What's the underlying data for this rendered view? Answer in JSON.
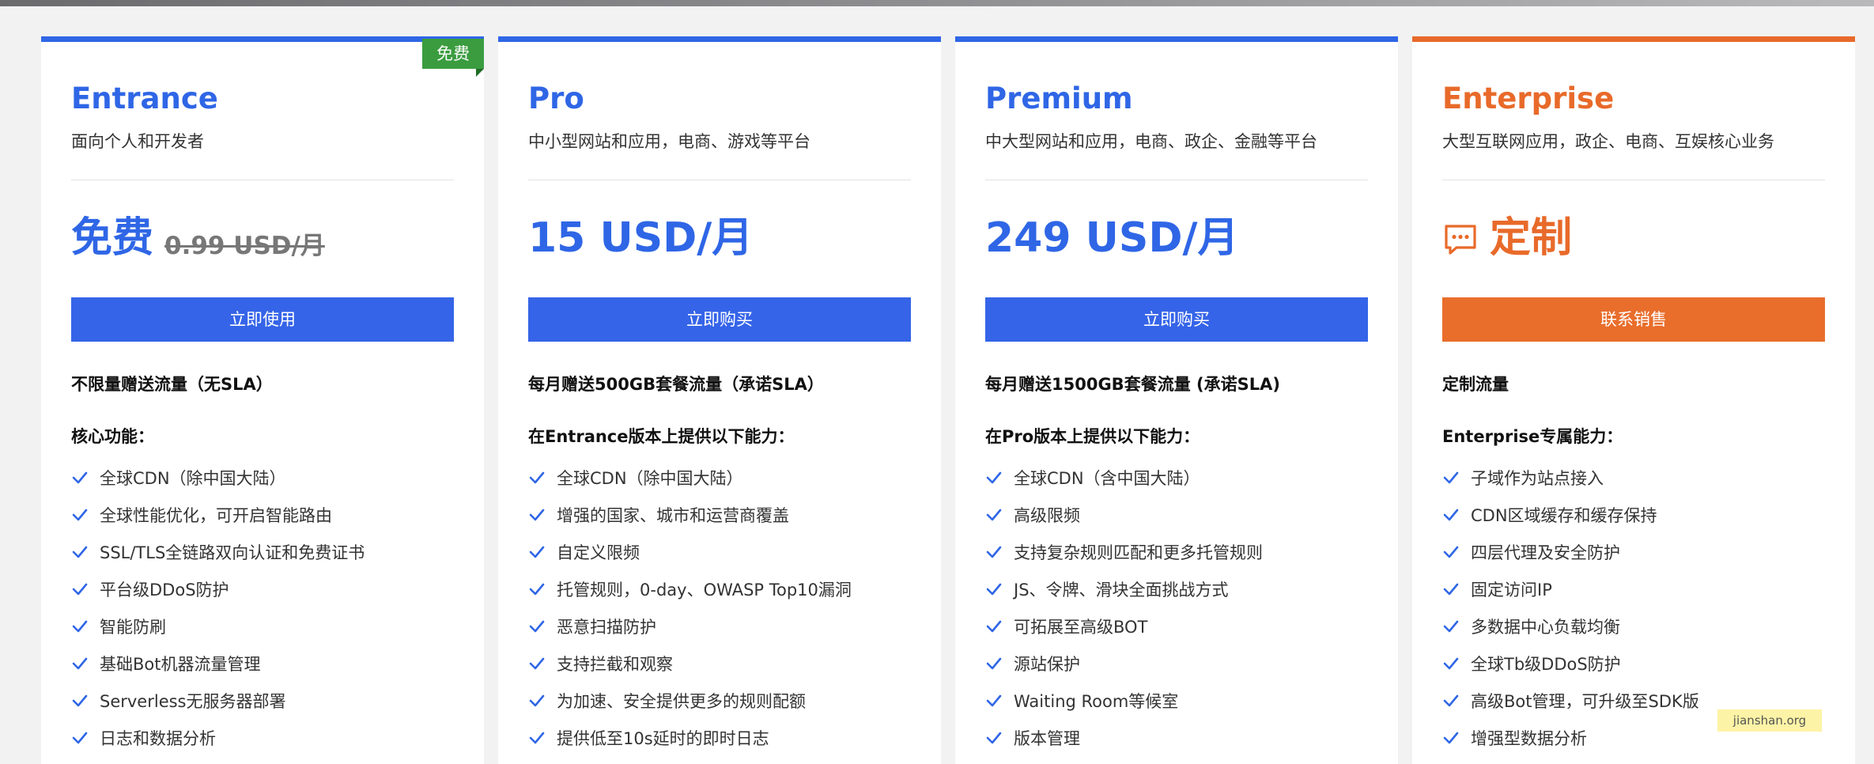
{
  "colors": {
    "blue": "#2f66e6",
    "orange": "#e86a2a",
    "green": "#3a9c3f"
  },
  "plans": [
    {
      "name": "Entrance",
      "badge": "免费",
      "description": "面向个人和开发者",
      "price": "免费",
      "old_price": "0.99 USD/月",
      "cta": "立即使用",
      "quota": "不限量赠送流量（无SLA）",
      "features_title": "核心功能：",
      "features": [
        "全球CDN（除中国大陆）",
        "全球性能优化，可开启智能路由",
        "SSL/TLS全链路双向认证和免费证书",
        "平台级DDoS防护",
        "智能防刷",
        "基础Bot机器流量管理",
        "Serverless无服务器部署",
        "日志和数据分析"
      ]
    },
    {
      "name": "Pro",
      "description": "中小型网站和应用，电商、游戏等平台",
      "price": "15 USD/月",
      "cta": "立即购买",
      "quota": "每月赠送500GB套餐流量（承诺SLA）",
      "features_title": "在Entrance版本上提供以下能力：",
      "features": [
        "全球CDN（除中国大陆）",
        "增强的国家、城市和运营商覆盖",
        "自定义限频",
        "托管规则，0-day、OWASP Top10漏洞",
        "恶意扫描防护",
        "支持拦截和观察",
        "为加速、安全提供更多的规则配额",
        "提供低至10s延时的即时日志"
      ]
    },
    {
      "name": "Premium",
      "description": "中大型网站和应用，电商、政企、金融等平台",
      "price": "249 USD/月",
      "cta": "立即购买",
      "quota": "每月赠送1500GB套餐流量 (承诺SLA)",
      "features_title": "在Pro版本上提供以下能力：",
      "features": [
        "全球CDN（含中国大陆）",
        "高级限频",
        "支持复杂规则匹配和更多托管规则",
        "JS、令牌、滑块全面挑战方式",
        "可拓展至高级BOT",
        "源站保护",
        "Waiting Room等候室",
        "版本管理"
      ]
    },
    {
      "name": "Enterprise",
      "description": "大型互联网应用，政企、电商、互娱核心业务",
      "price": "定制",
      "price_icon": "chat-icon",
      "cta": "联系销售",
      "quota": "定制流量",
      "features_title": "Enterprise专属能力：",
      "features": [
        "子域作为站点接入",
        "CDN区域缓存和缓存保持",
        "四层代理及安全防护",
        "固定访问IP",
        "多数据中心负载均衡",
        "全球Tb级DDoS防护",
        "高级Bot管理，可升级至SDK版",
        "增强型数据分析"
      ]
    }
  ],
  "watermark": "jianshan.org"
}
